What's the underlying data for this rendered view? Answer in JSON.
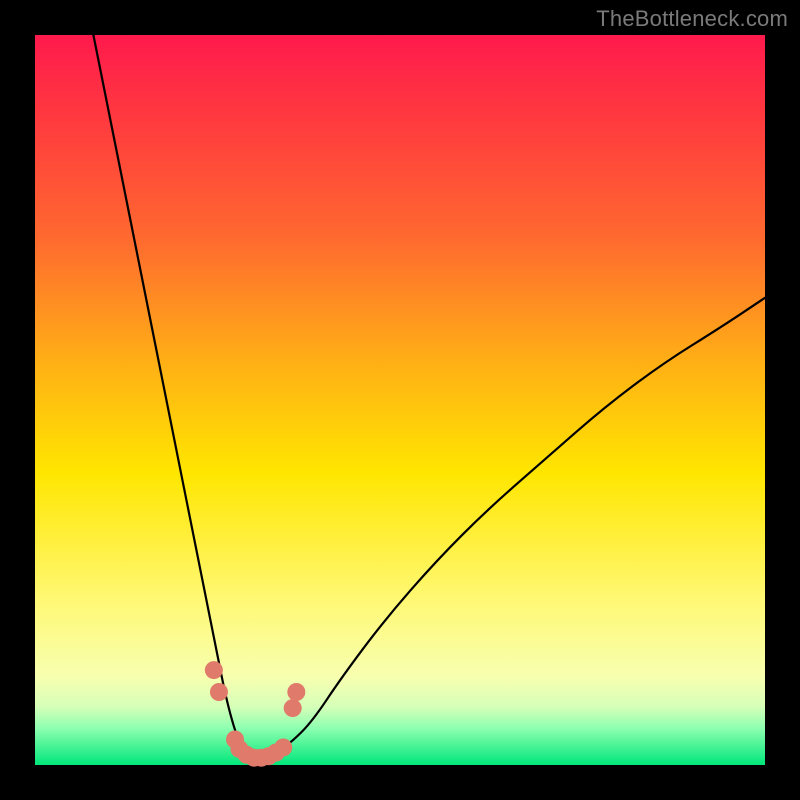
{
  "watermark": "TheBottleneck.com",
  "colors": {
    "frame": "#000000",
    "gradient_top": "#ff1a4d",
    "gradient_mid": "#ffe600",
    "gradient_bottom": "#00e67a",
    "curve": "#000000",
    "marker": "#e07a6a"
  },
  "chart_data": {
    "type": "line",
    "title": "",
    "xlabel": "",
    "ylabel": "",
    "xlim": [
      0,
      100
    ],
    "ylim": [
      0,
      100
    ],
    "grid": false,
    "legend": false,
    "series": [
      {
        "name": "bottleneck-curve",
        "x": [
          8,
          10,
          12,
          14,
          16,
          18,
          20,
          22,
          24,
          25,
          26,
          27,
          28,
          29,
          30,
          31,
          32,
          33,
          35,
          38,
          42,
          48,
          55,
          62,
          70,
          78,
          86,
          94,
          100
        ],
        "y": [
          100,
          90,
          80,
          70,
          60,
          50,
          40,
          30,
          20,
          15,
          10,
          6,
          3,
          1.5,
          1,
          1,
          1.2,
          1.8,
          3,
          6,
          12,
          20,
          28,
          35,
          42,
          49,
          55,
          60,
          64
        ]
      }
    ],
    "markers": [
      {
        "x": 24.5,
        "y": 13
      },
      {
        "x": 25.2,
        "y": 10
      },
      {
        "x": 27.4,
        "y": 3.5
      },
      {
        "x": 28.0,
        "y": 2.2
      },
      {
        "x": 29.0,
        "y": 1.4
      },
      {
        "x": 30.0,
        "y": 1.0
      },
      {
        "x": 31.0,
        "y": 1.0
      },
      {
        "x": 32.0,
        "y": 1.2
      },
      {
        "x": 33.0,
        "y": 1.7
      },
      {
        "x": 34.0,
        "y": 2.4
      },
      {
        "x": 35.3,
        "y": 7.8
      },
      {
        "x": 35.8,
        "y": 10
      }
    ],
    "marker_radius": 9
  }
}
